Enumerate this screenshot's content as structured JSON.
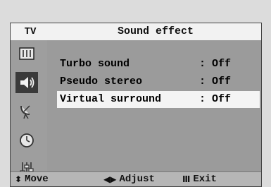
{
  "header": {
    "section": "TV",
    "title": "Sound effect"
  },
  "sidebar": {
    "icons": [
      "picture-icon",
      "sound-icon",
      "channel-icon",
      "time-icon",
      "setup-icon"
    ],
    "active": "sound-icon"
  },
  "menu": {
    "items": [
      {
        "label": "Turbo sound",
        "value": ": Off",
        "selected": false
      },
      {
        "label": "Pseudo stereo",
        "value": ": Off",
        "selected": false
      },
      {
        "label": "Virtual surround",
        "value": ": Off",
        "selected": true
      }
    ]
  },
  "footer": {
    "move": {
      "glyph": "⬍",
      "label": "Move"
    },
    "adjust": {
      "glyph": "◀▶",
      "label": "Adjust"
    },
    "exit": {
      "glyph": "Ⅲ",
      "label": "Exit"
    }
  },
  "colors": {
    "selected_row": "#f4f4f4",
    "active_icon_bg": "#3a3a3a",
    "panel": "#9b9b9b"
  }
}
